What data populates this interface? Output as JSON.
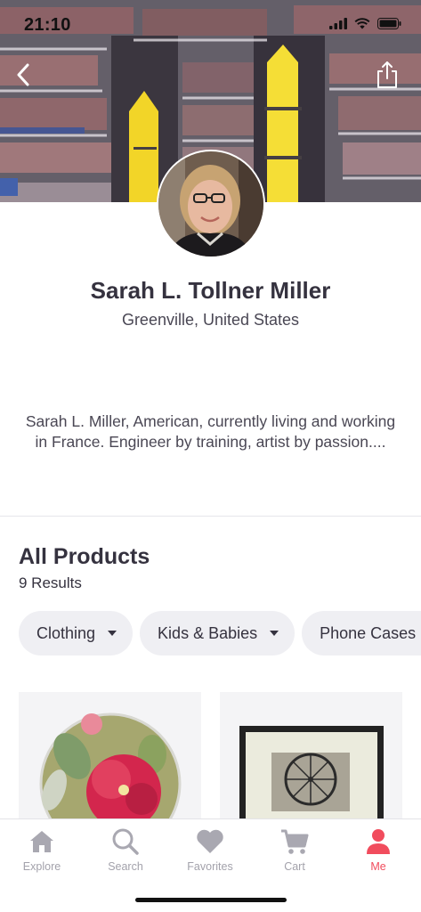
{
  "status_bar": {
    "time": "21:10"
  },
  "header": {
    "back_icon": "chevron-left-icon",
    "share_icon": "share-icon"
  },
  "profile": {
    "name": "Sarah L. Tollner Miller",
    "location": "Greenville, United States",
    "bio": "Sarah L. Miller, American, currently living and working in France. Engineer by training, artist by passion...."
  },
  "products": {
    "title": "All Products",
    "count": "9 Results",
    "filters": [
      {
        "label": "Clothing"
      },
      {
        "label": "Kids & Babies"
      },
      {
        "label": "Phone Cases"
      }
    ]
  },
  "tabbar": {
    "items": [
      {
        "label": "Explore",
        "icon": "home-icon"
      },
      {
        "label": "Search",
        "icon": "search-icon"
      },
      {
        "label": "Favorites",
        "icon": "heart-icon"
      },
      {
        "label": "Cart",
        "icon": "cart-icon"
      },
      {
        "label": "Me",
        "icon": "person-icon"
      }
    ],
    "active": "Me"
  },
  "colors": {
    "accent": "#f14c5d",
    "text_primary": "#35323f",
    "tab_inactive": "#a3a2ab",
    "chip_bg": "#efeff3"
  }
}
